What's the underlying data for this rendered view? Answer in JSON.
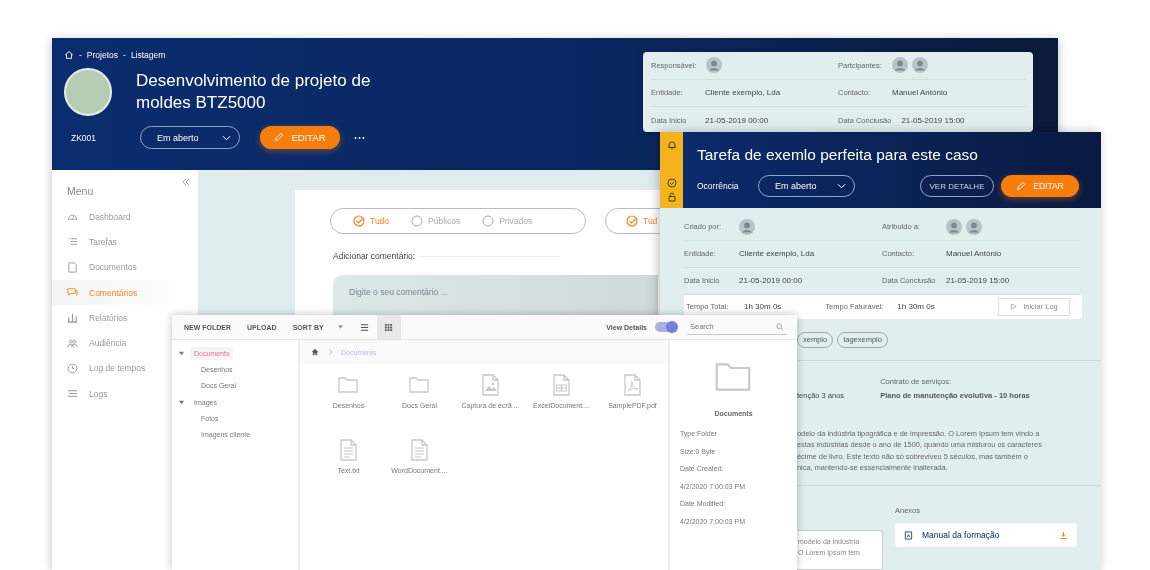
{
  "project": {
    "breadcrumb_separator": "-",
    "breadcrumb": [
      "Projetos",
      "Listagem"
    ],
    "title": "Desenvolvimento de projeto de moldes BTZ5000",
    "code": "ZK001",
    "status": "Em aberto",
    "edit_button": "EDITAR",
    "menu": {
      "title": "Menu",
      "items": [
        {
          "label": "Dashboard",
          "selected": false
        },
        {
          "label": "Tarefas",
          "selected": false
        },
        {
          "label": "Documentos",
          "selected": false
        },
        {
          "label": "Comentários",
          "selected": true
        },
        {
          "label": "Relatórios",
          "selected": false
        },
        {
          "label": "Audiência",
          "selected": false
        },
        {
          "label": "Log de tempos",
          "selected": false
        },
        {
          "label": "Logs",
          "selected": false
        }
      ]
    },
    "filters": [
      {
        "label": "Tudo",
        "selected": true
      },
      {
        "label": "Públicos",
        "selected": false
      },
      {
        "label": "Privados",
        "selected": false
      }
    ],
    "filters_2": [
      {
        "label": "Tud",
        "selected": true
      }
    ],
    "comment_label": "Adicionar comentário:",
    "comment_placeholder": "Digite o seu comentário ..."
  },
  "info_panel": {
    "rows": [
      [
        {
          "label": "Responsável:",
          "avatars": [
            {
              "kind": "photo"
            }
          ]
        },
        {
          "label": "Partcipantes:",
          "avatars": [
            {
              "kind": "photo"
            },
            {
              "kind": "photo"
            }
          ]
        }
      ],
      [
        {
          "label": "Entidade:",
          "value": "Cliente exemplo, Lda"
        },
        {
          "label": "Contacto:",
          "value": "Manuel António"
        }
      ],
      [
        {
          "label": "Data Inicio",
          "value": "21-05-2019 00:00"
        },
        {
          "label": "Data Conclusão",
          "value": "21-05-2019 15:00"
        }
      ]
    ]
  },
  "task": {
    "title": "Tarefa de exemlo perfeita para este caso",
    "occurrence_label": "Ocorrência",
    "status": "Em aberto",
    "detail_button": "VER DETALHE",
    "edit_button": "EDITAR",
    "rows": [
      [
        {
          "label": "Criado por:",
          "avatars": [
            {
              "kind": "photo"
            }
          ]
        },
        {
          "label": "Atribuido a:",
          "avatars": [
            {
              "kind": "photo"
            },
            {
              "kind": "photo"
            }
          ]
        }
      ],
      [
        {
          "label": "Entidade:",
          "value": "Cliente exemplo, Lda"
        },
        {
          "label": "Contacto:",
          "value": "Manuel António"
        }
      ],
      [
        {
          "label": "Data Inicio",
          "value": "21-05-2019 00:00"
        },
        {
          "label": "Data Conclusão",
          "value": "21-05-2019 15:00"
        }
      ]
    ],
    "time": {
      "total_label": "Tempo Total:",
      "total": "1h 30m 0s",
      "billable_label": "Tempo Faturável:",
      "billable": "1h 30m 0s",
      "start_button": "Iniciar Log"
    },
    "tags": [
      "xemplo",
      "tagexemplo"
    ],
    "plan_fragment": "tenção 3 anos",
    "contract_label": "Contrato de serviços:",
    "contract": "Plano de manutenção evolutiva - 10 horas",
    "description_lines": [
      "odelo da indústria tipográfica e de impressão. O Lorem Ipsum tem vindo a",
      "estas indústrias desde o ano de 1500, quando uma misturou os caracteres",
      "écime de livro. Este texto não só sobreviveu 5 séculos, mas também o",
      "nica, mantendo-se essencialmente inalterada."
    ],
    "note_lines": [
      "modelo da indústria",
      "O Lorem Ipsum tem"
    ],
    "attachments_label": "Anexos",
    "attachments": [
      {
        "name": "Manual da formação"
      }
    ]
  },
  "files": {
    "toolbar": [
      "NEW FOLDER",
      "UPLOAD",
      "SORT BY"
    ],
    "view_modes": [
      {
        "kind": "list",
        "selected": false
      },
      {
        "kind": "grid",
        "selected": true
      }
    ],
    "view_details": {
      "label": "View Details",
      "on": true
    },
    "search_placeholder": "Search",
    "tree": [
      {
        "label": "Documents",
        "selected": true,
        "expanded": true,
        "children": [
          {
            "label": "Desenhos",
            "selected": false
          },
          {
            "label": "Docs Geral",
            "selected": false
          }
        ]
      },
      {
        "label": "Images",
        "selected": false,
        "expanded": true,
        "children": [
          {
            "label": "Fotos",
            "selected": false
          },
          {
            "label": "Imagens cliente",
            "selected": false
          }
        ]
      }
    ],
    "path": [
      "Documents"
    ],
    "items": [
      {
        "name": "Desenhos",
        "kind": "folder"
      },
      {
        "name": "Docs Geral",
        "kind": "folder"
      },
      {
        "name": "Captura de ecrã ...",
        "kind": "image"
      },
      {
        "name": "ExcelDocument....",
        "kind": "sheet"
      },
      {
        "name": "SamplePDF.pdf",
        "kind": "pdf"
      },
      {
        "name": "Text.txt",
        "kind": "text"
      },
      {
        "name": "WordDocument....",
        "kind": "text"
      }
    ],
    "details": {
      "name": "Documents",
      "lines": [
        "Type:Folder",
        "Size:0 Byte",
        "Date Created:",
        "4/2/2020 7:00:03 PM",
        "Date Modified:",
        "4/2/2020 7:00:03 PM"
      ]
    }
  }
}
